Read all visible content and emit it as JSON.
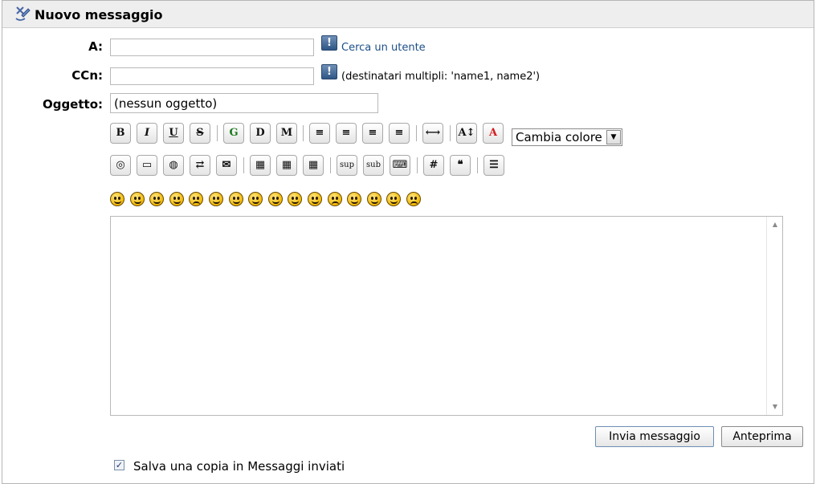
{
  "header": {
    "title": "Nuovo messaggio",
    "icon": "compose-icon"
  },
  "form": {
    "to": {
      "label": "A:",
      "value": "",
      "lookup_link": "Cerca un utente",
      "info_icon": "!"
    },
    "bcc": {
      "label": "CCn:",
      "value": "",
      "hint": "(destinatari multipli: 'name1, name2')",
      "info_icon": "!"
    },
    "subject": {
      "label": "Oggetto:",
      "value": "(nessun oggetto)"
    }
  },
  "toolbar": {
    "row1": [
      {
        "name": "bold-button",
        "glyph": "B"
      },
      {
        "name": "italic-button",
        "glyph": "I"
      },
      {
        "name": "underline-button",
        "glyph": "U"
      },
      {
        "name": "strikethrough-button",
        "glyph": "S"
      },
      {
        "name": "glow-button",
        "glyph": "G"
      },
      {
        "name": "shadow-button",
        "glyph": "D"
      },
      {
        "name": "marquee-button",
        "glyph": "M"
      },
      {
        "name": "preformatted-button",
        "glyph": "≡"
      },
      {
        "name": "align-left-button",
        "glyph": "≡"
      },
      {
        "name": "align-center-button",
        "glyph": "≡"
      },
      {
        "name": "align-right-button",
        "glyph": "≡"
      },
      {
        "name": "horizontal-rule-button",
        "glyph": "⟷"
      },
      {
        "name": "font-size-button",
        "glyph": "A↕"
      },
      {
        "name": "font-color-button",
        "glyph": "A"
      }
    ],
    "color_select": "Cambia colore",
    "row2": [
      {
        "name": "flash-button",
        "glyph": "◎"
      },
      {
        "name": "image-button",
        "glyph": "▭"
      },
      {
        "name": "hyperlink-button",
        "glyph": "◍"
      },
      {
        "name": "ftp-link-button",
        "glyph": "⇄"
      },
      {
        "name": "email-link-button",
        "glyph": "✉"
      },
      {
        "name": "table-button",
        "glyph": "▦"
      },
      {
        "name": "table-row-button",
        "glyph": "▦"
      },
      {
        "name": "table-column-button",
        "glyph": "▦"
      },
      {
        "name": "superscript-button",
        "glyph": "sup"
      },
      {
        "name": "subscript-button",
        "glyph": "sub"
      },
      {
        "name": "teletype-button",
        "glyph": "⌨"
      },
      {
        "name": "code-button",
        "glyph": "#"
      },
      {
        "name": "quote-button",
        "glyph": "❝"
      },
      {
        "name": "list-button",
        "glyph": "☰"
      }
    ]
  },
  "smileys_count": 16,
  "message": {
    "value": ""
  },
  "actions": {
    "send": "Invia messaggio",
    "preview": "Anteprima"
  },
  "options": {
    "save_copy_label": "Salva una copia in Messaggi inviati",
    "save_copy_checked": true
  },
  "colors": {
    "accent": "#1d4e86",
    "titlebar": "#eeeeee",
    "border": "#b9b9b9"
  }
}
